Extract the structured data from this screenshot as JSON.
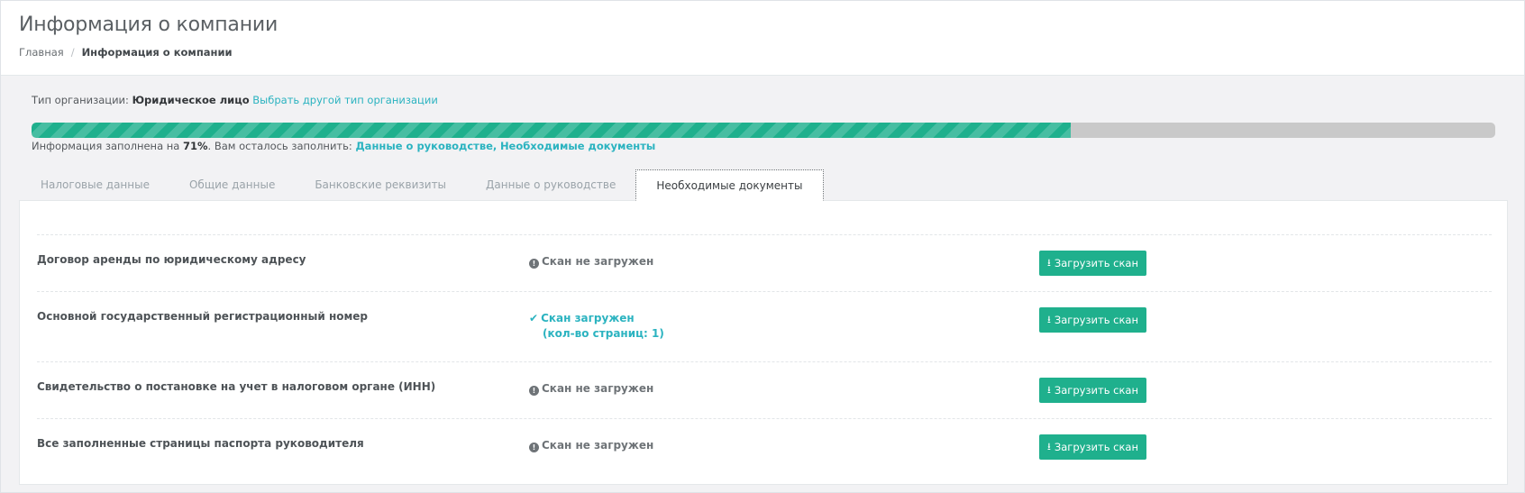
{
  "header": {
    "title": "Информация о компании",
    "breadcrumb": {
      "home": "Главная",
      "separator": "/",
      "current": "Информация о компании"
    }
  },
  "org": {
    "label": "Тип организации:",
    "value": "Юридическое лицо",
    "change_link": "Выбрать другой тип организации"
  },
  "progress": {
    "percent": 71,
    "note_prefix": "Информация заполнена на",
    "percent_label": "71%",
    "note_middle": ". Вам осталось заполнить:",
    "remaining_1": "Данные о руководстве",
    "remaining_sep": ",",
    "remaining_2": "Необходимые документы",
    "fill_color": "#1fb08d",
    "track_color": "#c9c9c9"
  },
  "tabs": [
    {
      "label": "Налоговые данные",
      "active": false
    },
    {
      "label": "Общие данные",
      "active": false
    },
    {
      "label": "Банковские реквизиты",
      "active": false
    },
    {
      "label": "Данные о руководстве",
      "active": false
    },
    {
      "label": "Необходимые документы",
      "active": true
    }
  ],
  "documents": [
    {
      "name": "Договор аренды по юридическому адресу",
      "status": "Скан не загружен",
      "status_type": "missing",
      "button": "Загрузить скан"
    },
    {
      "name": "Основной государственный регистрационный номер",
      "status": "Скан загружен",
      "status_sub": "(кол-во страниц: 1)",
      "status_type": "uploaded",
      "button": "Загрузить скан"
    },
    {
      "name": "Свидетельство о постановке на учет в налоговом органе (ИНН)",
      "status": "Скан не загружен",
      "status_type": "missing",
      "button": "Загрузить скан"
    },
    {
      "name": "Все заполненные страницы паспорта руководителя",
      "status": "Скан не загружен",
      "status_type": "missing",
      "button": "Загрузить скан"
    }
  ],
  "icons": {
    "missing": "exclamation-circle-icon",
    "uploaded": "check-icon",
    "upload": "download-icon"
  },
  "colors": {
    "accent": "#1fb08d",
    "link": "#2bb3c0"
  }
}
